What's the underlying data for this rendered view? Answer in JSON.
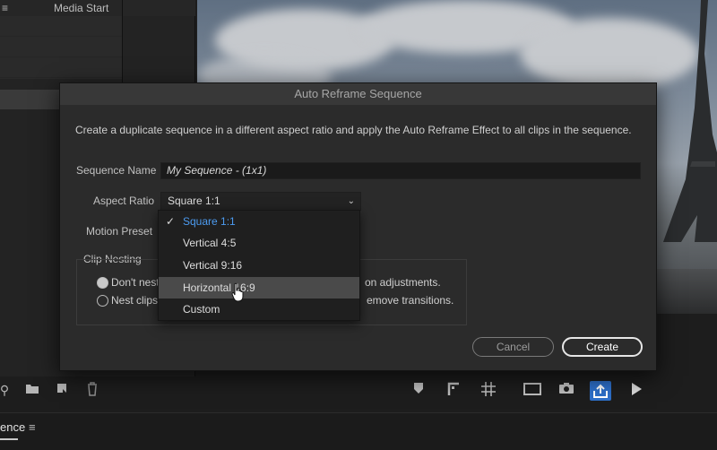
{
  "app": {
    "project_columns": [
      "Media Start"
    ],
    "bottom_tab": "ence",
    "bottom_tab_menu": "≡"
  },
  "dialog": {
    "title": "Auto Reframe Sequence",
    "description": "Create a duplicate sequence in a different aspect ratio and apply the Auto Reframe Effect to all clips in the sequence.",
    "sequence_name_label": "Sequence Name",
    "sequence_name_value": "My Sequence - (1x1)",
    "aspect_ratio_label": "Aspect Ratio",
    "aspect_ratio_value": "Square 1:1",
    "motion_preset_label": "Motion Preset",
    "clip_nesting_label": "Clip Nesting",
    "radio_dont_nest": "Don't nest",
    "radio_nest_clips": "Nest clips",
    "dont_nest_tail": "on adjustments.",
    "nest_clips_tail": "emove transitions.",
    "cancel_label": "Cancel",
    "create_label": "Create"
  },
  "dropdown": {
    "options": [
      {
        "label": "Square 1:1",
        "selected": true
      },
      {
        "label": "Vertical 4:5",
        "selected": false
      },
      {
        "label": "Vertical 9:16",
        "selected": false
      },
      {
        "label": "Horizontal 16:9",
        "selected": false,
        "hovered": true
      },
      {
        "label": "Custom",
        "selected": false
      }
    ],
    "check_glyph": "✓"
  },
  "icons": {
    "chevron": "⌄",
    "colors": {
      "accent": "#2d6fc9",
      "selected_option": "#4c9bf0"
    }
  }
}
